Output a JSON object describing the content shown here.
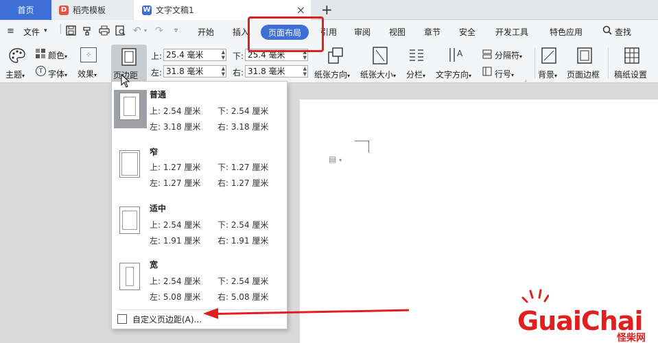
{
  "tabs": {
    "home": "首页",
    "template": "稻壳模板",
    "doc": "文字文稿1",
    "doc_icon": "W",
    "template_icon": "D",
    "close": "×",
    "add": "+"
  },
  "menu": {
    "file": "文件",
    "items": [
      "开始",
      "插入",
      "页面布局",
      "引用",
      "审阅",
      "视图",
      "章节",
      "安全",
      "开发工具",
      "特色应用",
      "查找"
    ],
    "active": "页面布局"
  },
  "ribbon": {
    "theme": "主题",
    "color": "颜色",
    "font": "字体",
    "effect": "效果",
    "margins": "页边距",
    "top_label": "上:",
    "top_value": "25.4 毫米",
    "bottom_label": "下:",
    "bottom_value": "25.4 毫米",
    "left_label": "左:",
    "left_value": "31.8 毫米",
    "right_label": "右:",
    "right_value": "31.8 毫米",
    "orientation": "纸张方向",
    "size": "纸张大小",
    "columns": "分栏",
    "text_direction": "文字方向",
    "separator": "分隔符",
    "line_number": "行号",
    "background": "背景",
    "page_border": "页面边框",
    "grid_setup": "稿纸设置"
  },
  "margins_menu": {
    "presets": [
      {
        "name": "普通",
        "top": "上: 2.54 厘米",
        "bottom": "下: 2.54 厘米",
        "left": "左: 3.18 厘米",
        "right": "右: 3.18 厘米"
      },
      {
        "name": "窄",
        "top": "上: 1.27 厘米",
        "bottom": "下: 1.27 厘米",
        "left": "左: 1.27 厘米",
        "right": "右: 1.27 厘米"
      },
      {
        "name": "适中",
        "top": "上: 2.54 厘米",
        "bottom": "下: 2.54 厘米",
        "left": "左: 1.91 厘米",
        "right": "右: 1.91 厘米"
      },
      {
        "name": "宽",
        "top": "上: 2.54 厘米",
        "bottom": "下: 2.54 厘米",
        "left": "左: 5.08 厘米",
        "right": "右: 5.08 厘米"
      }
    ],
    "custom": "自定义页边距(A)..."
  },
  "watermark": {
    "main": "GuaiChai",
    "sub": "怪柴网"
  },
  "colors": {
    "accent": "#3d6fd6",
    "annotation": "#e02020"
  }
}
